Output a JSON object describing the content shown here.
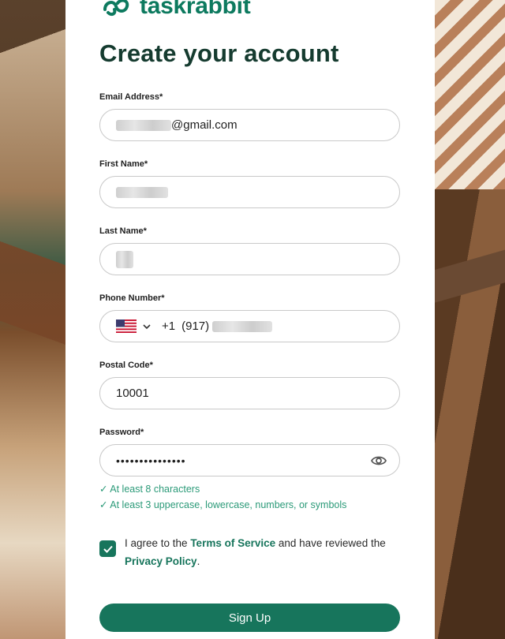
{
  "brand": {
    "name": "taskrabbit",
    "color": "#0d7a5f"
  },
  "page": {
    "title": "Create your account"
  },
  "form": {
    "email": {
      "label": "Email Address*",
      "value_visible": "@gmail.com"
    },
    "first_name": {
      "label": "First Name*"
    },
    "last_name": {
      "label": "Last Name*"
    },
    "phone": {
      "label": "Phone Number*",
      "country_code": "+1",
      "area_code": "(917)",
      "flag_icon": "us-flag-icon"
    },
    "postal_code": {
      "label": "Postal Code*",
      "value": "10001"
    },
    "password": {
      "label": "Password*",
      "value_masked": "•••••••••••••••"
    },
    "password_hints": [
      "✓ At least 8 characters",
      "✓ At least 3 uppercase, lowercase, numbers, or symbols"
    ],
    "agree": {
      "checked": true,
      "prefix": "I agree to the ",
      "terms_link": "Terms of Service",
      "middle": " and have reviewed the ",
      "privacy_link": "Privacy Policy",
      "suffix": "."
    },
    "submit_label": "Sign Up"
  },
  "colors": {
    "accent": "#17755c",
    "title": "#153b2f",
    "hint": "#2b9a78"
  }
}
